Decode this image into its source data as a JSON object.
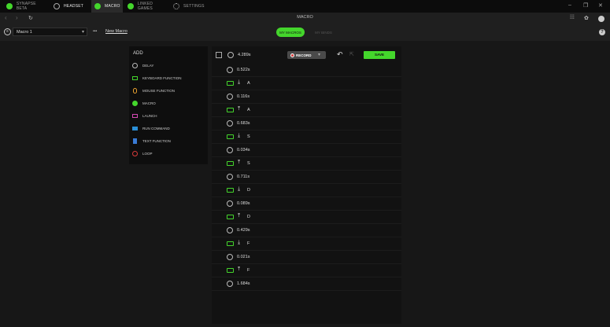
{
  "tabs": [
    {
      "label": "SYNAPSE BETA",
      "active": false,
      "icon": "synapse-icon"
    },
    {
      "label": "HEADSET",
      "active": false,
      "icon": "headset-icon"
    },
    {
      "label": "MACRO",
      "active": true,
      "icon": "macro-icon"
    },
    {
      "label": "LINKED GAMES",
      "active": false,
      "icon": "linked-games-icon"
    },
    {
      "label": "SETTINGS",
      "active": false,
      "icon": "gear-icon"
    }
  ],
  "window_controls": [
    "–",
    "❐",
    "✕"
  ],
  "nav": {
    "title": "MACRO"
  },
  "macro_select": {
    "value": "Macro 1",
    "more": "•••",
    "new_macro": "New Macro"
  },
  "modes": {
    "my_macros": "MY MACROS",
    "my_binds": "MY BINDS"
  },
  "add_panel": {
    "title": "ADD",
    "items": [
      {
        "label": "DELAY",
        "icon": "clock-icon"
      },
      {
        "label": "KEYBOARD FUNCTION",
        "icon": "keyboard-icon"
      },
      {
        "label": "MOUSE FUNCTION",
        "icon": "mouse-icon"
      },
      {
        "label": "MACRO",
        "icon": "macro-icon"
      },
      {
        "label": "LAUNCH",
        "icon": "folder-icon"
      },
      {
        "label": "RUN COMMAND",
        "icon": "terminal-icon"
      },
      {
        "label": "TEXT FUNCTION",
        "icon": "text-icon"
      },
      {
        "label": "LOOP",
        "icon": "loop-icon"
      }
    ]
  },
  "list_header": {
    "total": "4.289s",
    "record": "RECORD",
    "save": "SAVE"
  },
  "events": [
    {
      "type": "delay",
      "value": "0.522s"
    },
    {
      "type": "key",
      "dir": "down",
      "value": "A"
    },
    {
      "type": "delay",
      "value": "0.116s"
    },
    {
      "type": "key",
      "dir": "up",
      "value": "A"
    },
    {
      "type": "delay",
      "value": "0.683s"
    },
    {
      "type": "key",
      "dir": "down",
      "value": "S"
    },
    {
      "type": "delay",
      "value": "0.034s"
    },
    {
      "type": "key",
      "dir": "up",
      "value": "S"
    },
    {
      "type": "delay",
      "value": "0.711s"
    },
    {
      "type": "key",
      "dir": "down",
      "value": "D"
    },
    {
      "type": "delay",
      "value": "0.089s"
    },
    {
      "type": "key",
      "dir": "up",
      "value": "D"
    },
    {
      "type": "delay",
      "value": "0.429s"
    },
    {
      "type": "key",
      "dir": "down",
      "value": "F"
    },
    {
      "type": "delay",
      "value": "0.021s"
    },
    {
      "type": "key",
      "dir": "up",
      "value": "F"
    },
    {
      "type": "delay",
      "value": "1.684s"
    }
  ],
  "colors": {
    "accent": "#44d62c",
    "record": "#d93a3a"
  }
}
